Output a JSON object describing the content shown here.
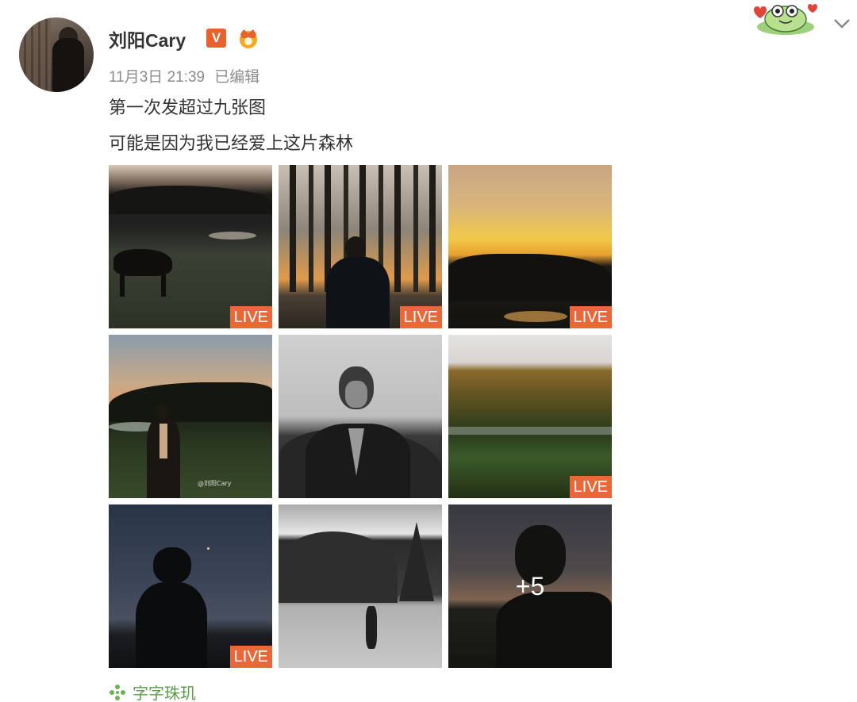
{
  "post": {
    "username": "刘阳Cary",
    "verified_badge": "V",
    "date": "11月3日 21:39",
    "edited": "已编辑",
    "line1": "第一次发超过九张图",
    "line2": "可能是因为我已经爱上这片森林"
  },
  "gallery": {
    "live_label": "LIVE",
    "more_label": "+5",
    "watermark": "@刘阳Cary"
  },
  "footer": {
    "topic": "字字珠玑"
  },
  "colors": {
    "badge": "#e8622e",
    "live": "#e8683a",
    "topic": "#5a9e4a"
  }
}
